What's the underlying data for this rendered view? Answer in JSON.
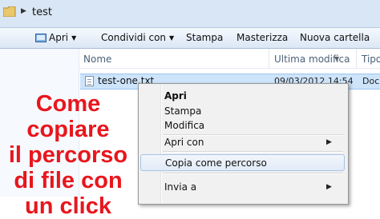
{
  "address_bar": {
    "path_label": "test"
  },
  "toolbar": {
    "open_label": "Apri",
    "share_label": "Condividi con",
    "print_label": "Stampa",
    "burn_label": "Masterizza",
    "new_folder_label": "Nuova cartella"
  },
  "columns": {
    "name": "Nome",
    "modified": "Ultima modifica",
    "type": "Tipo"
  },
  "file": {
    "name": "test-one.txt",
    "modified": "09/03/2012 14:54",
    "type": "Docu"
  },
  "context_menu": {
    "items": [
      "Apri",
      "Stampa",
      "Modifica",
      "Apri con",
      "Copia come percorso",
      "Invia a"
    ]
  },
  "overlay_text": {
    "line1": "Come copiare",
    "line2": "il percorso",
    "line3": "di file con",
    "line4": "un click"
  },
  "colors": {
    "overlay": "#e8161d",
    "selection": "#cde4fb",
    "toolbar": "#dce7f5"
  }
}
